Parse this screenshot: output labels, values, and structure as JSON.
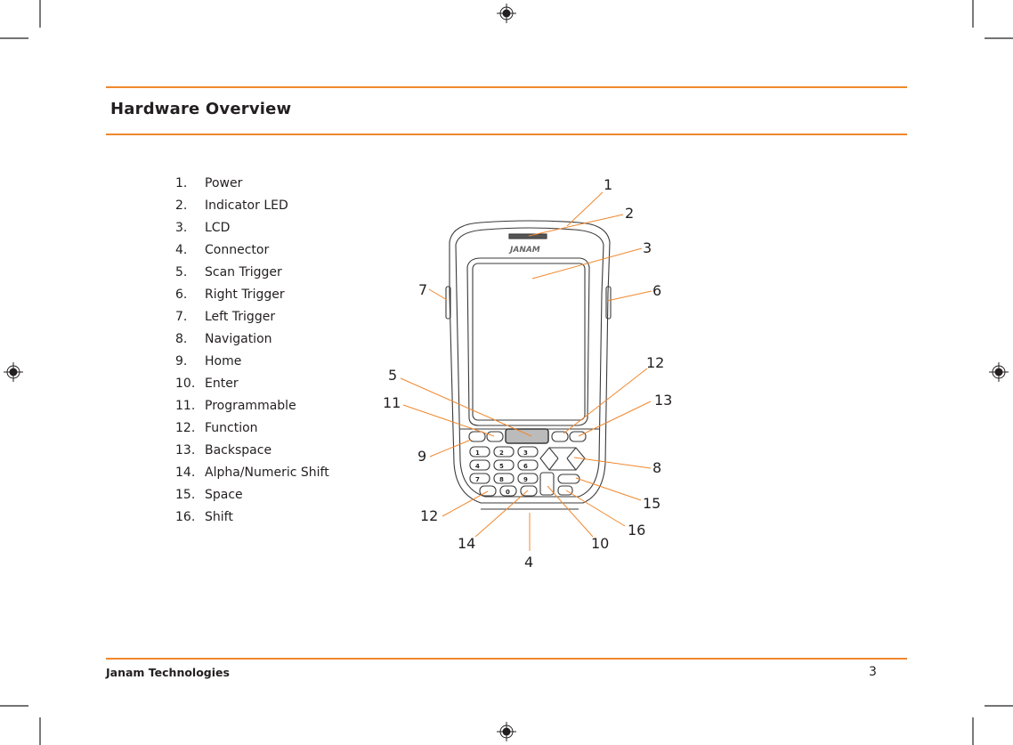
{
  "header": {
    "title": "Hardware Overview"
  },
  "parts_list": [
    {
      "number": "1.",
      "label": "Power"
    },
    {
      "number": "2.",
      "label": "Indicator LED"
    },
    {
      "number": "3.",
      "label": "LCD"
    },
    {
      "number": "4.",
      "label": "Connector"
    },
    {
      "number": "5.",
      "label": "Scan Trigger"
    },
    {
      "number": "6.",
      "label": "Right Trigger"
    },
    {
      "number": "7.",
      "label": "Left Trigger"
    },
    {
      "number": "8.",
      "label": "Navigation"
    },
    {
      "number": "9.",
      "label": "Home"
    },
    {
      "number": "10.",
      "label": "Enter"
    },
    {
      "number": "11.",
      "label": "Programmable"
    },
    {
      "number": "12.",
      "label": "Function"
    },
    {
      "number": "13.",
      "label": "Backspace"
    },
    {
      "number": "14.",
      "label": "Alpha/Numeric Shift"
    },
    {
      "number": "15.",
      "label": "Space"
    },
    {
      "number": "16.",
      "label": "Shift"
    }
  ],
  "diagram": {
    "brand_logo_text": "JANAM",
    "callouts": [
      "1",
      "2",
      "3",
      "6",
      "7",
      "12",
      "5",
      "11",
      "13",
      "9",
      "8",
      "15",
      "12",
      "16",
      "14",
      "10",
      "4"
    ],
    "keypad_keys": [
      "1",
      "2",
      "3",
      "4",
      "5",
      "6",
      "7",
      "8",
      "9",
      "0"
    ],
    "accent_color": "#f0882e"
  },
  "footer": {
    "company": "Janam Technologies",
    "page_number": "3"
  },
  "colors": {
    "rule": "#f0882e",
    "text": "#231f20"
  }
}
